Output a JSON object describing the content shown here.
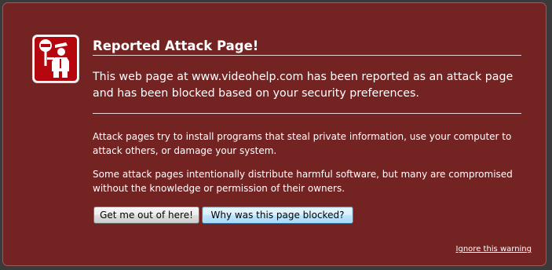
{
  "page": {
    "title": "Reported Attack Page!",
    "summary": "This web page at www.videohelp.com has been reported as an attack page and has been blocked based on your security preferences.",
    "paragraphs": [
      "Attack pages try to install programs that steal private information, use your computer to attack others, or damage your system.",
      "Some attack pages intentionally distribute harmful software, but many are compromised without the knowledge or permission of their owners."
    ],
    "buttons": {
      "get_out": "Get me out of here!",
      "why_blocked": "Why was this page blocked?"
    },
    "ignore_link": "Ignore this warning"
  },
  "icon": {
    "name": "police-officer-stop-icon",
    "background": "#b5080e",
    "foreground": "#ffffff"
  },
  "colors": {
    "page_background": "#722322",
    "outer_background": "#3a3a3a",
    "text": "#ffffff"
  }
}
